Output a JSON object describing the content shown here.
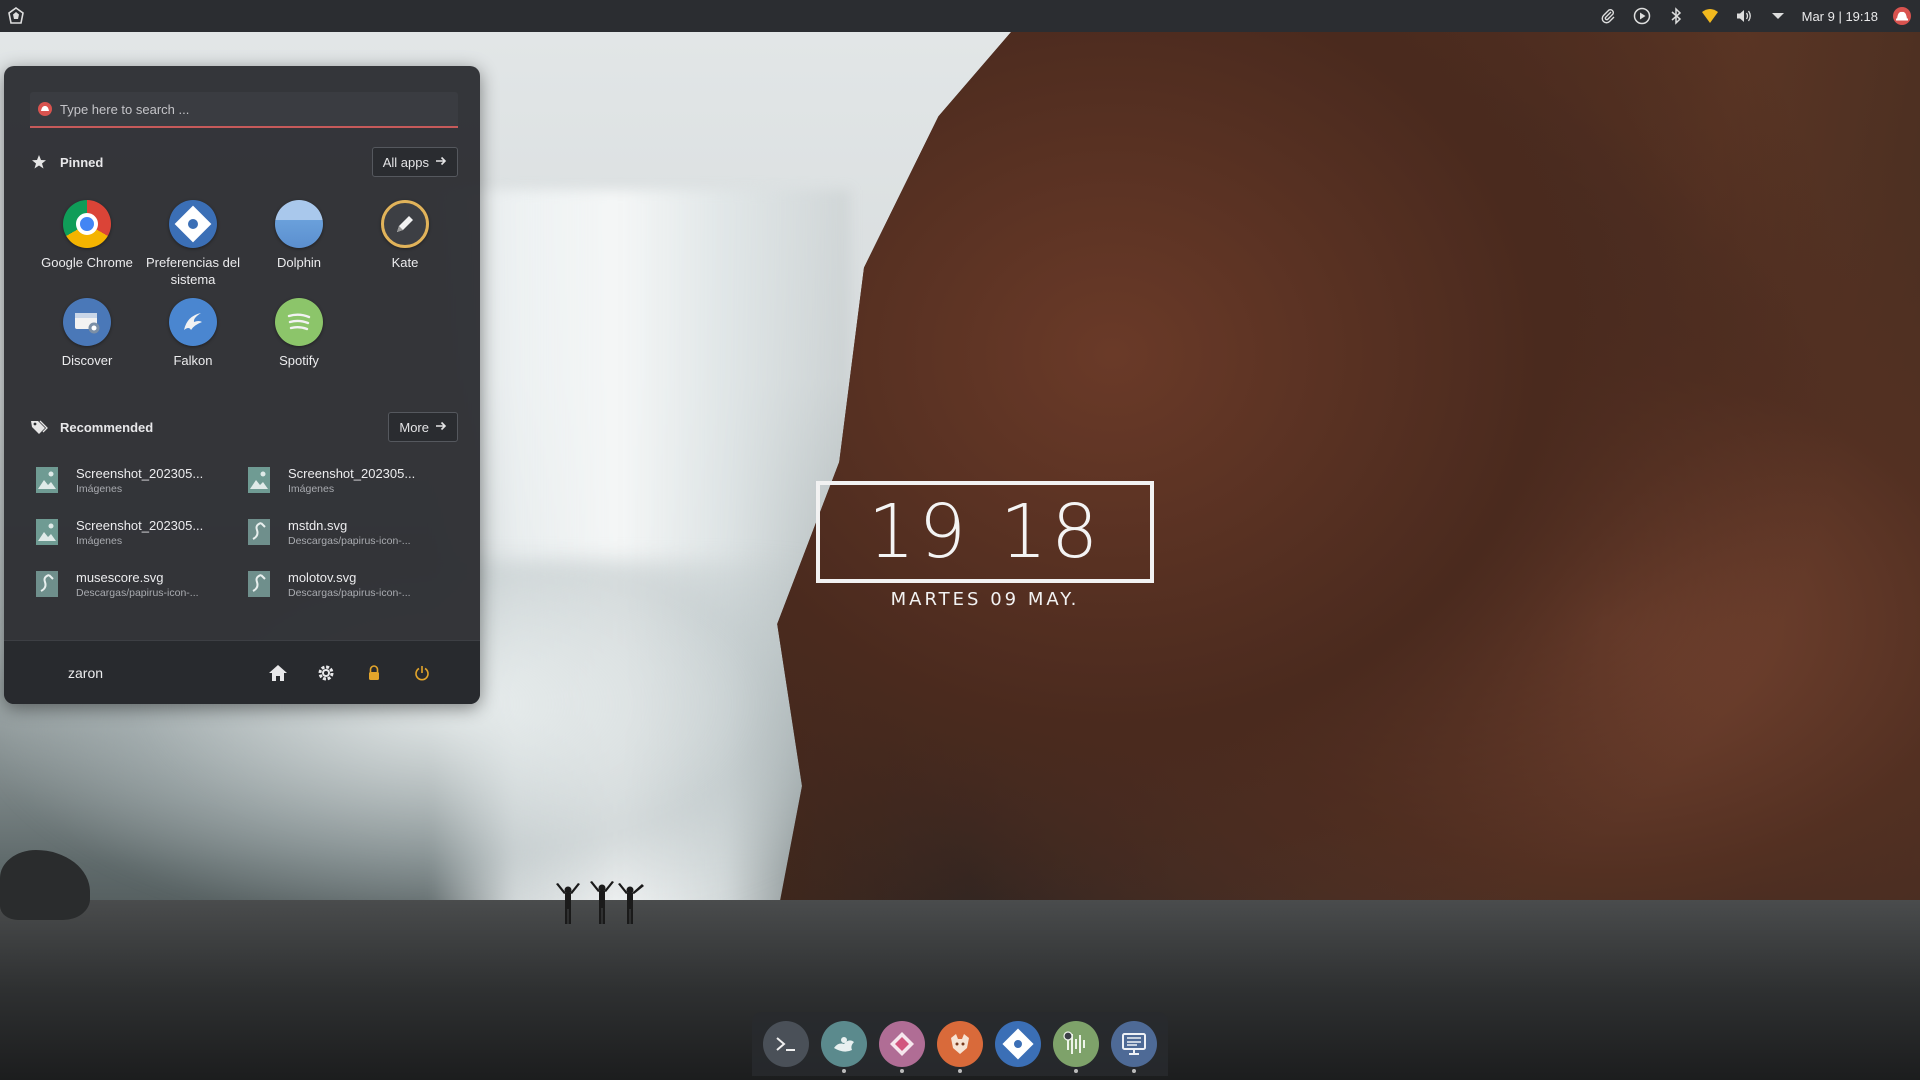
{
  "top_panel": {
    "clock_text": "Mar 9 | 19:18",
    "tray_icons": [
      "paperclip-icon",
      "play-icon",
      "bluetooth-icon",
      "wifi-icon",
      "volume-icon",
      "expand-tray-icon",
      "notifications-icon"
    ]
  },
  "launcher": {
    "search_placeholder": "Type here to search ...",
    "pinned": {
      "title": "Pinned",
      "all_apps_label": "All apps",
      "apps": [
        {
          "label": "Google Chrome",
          "icon": "chrome-icon"
        },
        {
          "label": "Preferencias del sistema",
          "icon": "system-settings-icon"
        },
        {
          "label": "Dolphin",
          "icon": "dolphin-folder-icon"
        },
        {
          "label": "Kate",
          "icon": "kate-pen-icon"
        },
        {
          "label": "Discover",
          "icon": "discover-store-icon"
        },
        {
          "label": "Falkon",
          "icon": "falkon-icon"
        },
        {
          "label": "Spotify",
          "icon": "spotify-icon"
        }
      ]
    },
    "recommended": {
      "title": "Recommended",
      "more_label": "More",
      "items": [
        {
          "name": "Screenshot_202305...",
          "location": "Imágenes",
          "icon": "image-file-icon"
        },
        {
          "name": "Screenshot_202305...",
          "location": "Imágenes",
          "icon": "image-file-icon"
        },
        {
          "name": "Screenshot_202305...",
          "location": "Imágenes",
          "icon": "image-file-icon"
        },
        {
          "name": "mstdn.svg",
          "location": "Descargas/papirus-icon-...",
          "icon": "svg-file-icon"
        },
        {
          "name": "musescore.svg",
          "location": "Descargas/papirus-icon-...",
          "icon": "svg-file-icon"
        },
        {
          "name": "molotov.svg",
          "location": "Descargas/papirus-icon-...",
          "icon": "svg-file-icon"
        }
      ]
    },
    "footer": {
      "user_name": "zaron",
      "buttons": [
        "home-icon",
        "settings-icon",
        "lock-icon",
        "power-icon"
      ]
    }
  },
  "clock_widget": {
    "hours": "19",
    "minutes": "18",
    "date": "MARTES 09 MAY."
  },
  "dock": {
    "items": [
      "terminal-icon",
      "plasma-icon",
      "krita-icon",
      "firefox-icon",
      "system-settings-icon",
      "audio-app-icon",
      "display-icon"
    ]
  },
  "colors": {
    "accent": "#c65a5a",
    "panel": "#2b2d31",
    "launcher_bg": "#2e3034"
  }
}
